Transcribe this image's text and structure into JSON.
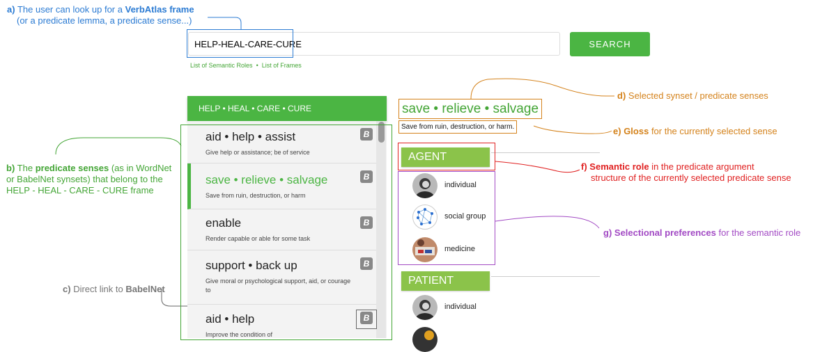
{
  "annotations": {
    "a_label": "a)",
    "a_text1": "The user can look up for a",
    "a_bold": "VerbAtlas frame",
    "a_line2": "(or a predicate lemma, a predicate sense...)",
    "b_label": "b)",
    "b_text1": "The",
    "b_bold": "predicate senses",
    "b_text2": "(as in WordNet",
    "b_line2": "or BabelNet synsets) that belong to the",
    "b_line3": "HELP - HEAL - CARE - CURE frame",
    "c_label": "c)",
    "c_text": "Direct link to",
    "c_bold": "BabelNet",
    "d_label": "d)",
    "d_text": "Selected synset / predicate senses",
    "e_label": "e)",
    "e_bold": "Gloss",
    "e_text": "for the currently selected sense",
    "f_label": "f)",
    "f_bold": "Semantic role",
    "f_text": "in the predicate argument",
    "f_line2": "structure of the currently selected predicate sense",
    "g_label": "g)",
    "g_bold": "Selectional preferences",
    "g_text": "for the semantic role"
  },
  "search": {
    "value": "HELP-HEAL-CARE-CURE",
    "button": "SEARCH",
    "link_roles": "List of Semantic Roles",
    "link_sep": "•",
    "link_frames": "List of Frames"
  },
  "frame": {
    "header": "HELP • HEAL • CARE • CURE"
  },
  "senses": [
    {
      "title": "aid • help • assist",
      "desc": "Give help or assistance; be of service"
    },
    {
      "title": "save • relieve • salvage",
      "desc": "Save from ruin, destruction, or harm"
    },
    {
      "title": "enable",
      "desc": "Render capable or able for some task"
    },
    {
      "title": "support • back up",
      "desc": "Give moral or psychological support, aid, or courage to"
    },
    {
      "title": "aid • help",
      "desc": "Improve the condition of"
    }
  ],
  "babelnet_icon": "B",
  "selected": {
    "title": "save • relieve • salvage",
    "gloss": "Save from ruin, destruction, or harm."
  },
  "roles": {
    "agent": "AGENT",
    "agent_prefs": [
      "individual",
      "social group",
      "medicine"
    ],
    "patient": "PATIENT",
    "patient_prefs": [
      "individual"
    ]
  },
  "colors": {
    "green": "#4bb543",
    "blue": "#2b7bd3",
    "orange": "#d4821b",
    "red": "#e02020",
    "purple": "#a24ac4"
  }
}
